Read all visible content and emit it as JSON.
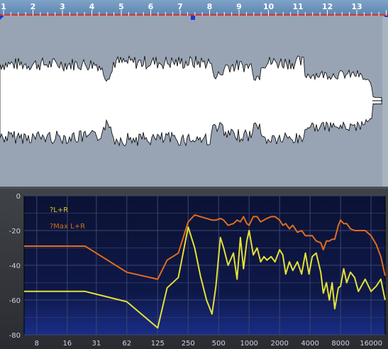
{
  "waveform": {
    "ruler_labels": [
      "1",
      "2",
      "3",
      "4",
      "5",
      "6",
      "7",
      "8",
      "9",
      "10",
      "11",
      "12",
      "13"
    ],
    "colors": {
      "background": "#98a4b3",
      "wave_fill": "#ffffff",
      "ruler_bg": "#6a90b9",
      "ruler_line": "#c83a36",
      "marker": "#1e39c8"
    }
  },
  "spectrum": {
    "legend": {
      "lr_label": "?L+R",
      "max_label": "?Max L+R"
    },
    "colors": {
      "plot_bg_top": "#0c1233",
      "plot_bg_bottom": "#1a2d88",
      "grid": "#3c4670",
      "lr_line": "#e3e037",
      "max_line": "#e26c1c",
      "label_text": "#cfd3da",
      "lr_legend": "#d6cd2c",
      "max_legend": "#d2701c"
    },
    "y_tick_labels": [
      "0",
      "-20",
      "-40",
      "-60",
      "-80"
    ],
    "x_tick_labels": [
      "8",
      "16",
      "31",
      "62",
      "125",
      "250",
      "500",
      "1000",
      "2000",
      "4000",
      "8000",
      "16000"
    ]
  },
  "chart_data": {
    "type": "line",
    "xscale": "log",
    "xlabel": "",
    "ylabel": "",
    "xlim": [
      6,
      22050
    ],
    "ylim": [
      -80,
      0
    ],
    "grid": true,
    "legend_position": "top-left",
    "series": [
      {
        "name": "?L+R",
        "x": [
          6,
          16,
          24,
          62,
          125,
          155,
          200,
          250,
          290,
          330,
          380,
          430,
          470,
          520,
          560,
          620,
          700,
          760,
          820,
          880,
          950,
          1000,
          1100,
          1200,
          1300,
          1400,
          1500,
          1650,
          1800,
          2000,
          2150,
          2300,
          2500,
          2700,
          3000,
          3300,
          3600,
          3900,
          4200,
          4600,
          5100,
          5400,
          5800,
          6200,
          6600,
          7000,
          7600,
          8000,
          8600,
          9200,
          10000,
          11000,
          12000,
          14000,
          16000,
          18000,
          20000,
          22000
        ],
        "values": [
          -55,
          -55,
          -55,
          -61,
          -76,
          -53,
          -47,
          -18,
          -30,
          -46,
          -60,
          -68,
          -52,
          -24,
          -30,
          -40,
          -33,
          -48,
          -24,
          -42,
          -26,
          -20,
          -34,
          -30,
          -38,
          -35,
          -37,
          -35,
          -38,
          -31,
          -34,
          -45,
          -38,
          -43,
          -38,
          -45,
          -33,
          -45,
          -35,
          -33,
          -44,
          -56,
          -50,
          -60,
          -50,
          -65,
          -53,
          -52,
          -42,
          -50,
          -44,
          -47,
          -55,
          -48,
          -55,
          -52,
          -48,
          -60
        ]
      },
      {
        "name": "?Max L+R",
        "x": [
          6,
          16,
          24,
          62,
          125,
          155,
          200,
          250,
          290,
          330,
          380,
          430,
          470,
          520,
          560,
          620,
          700,
          760,
          820,
          880,
          950,
          1000,
          1100,
          1200,
          1300,
          1400,
          1500,
          1650,
          1800,
          2000,
          2150,
          2300,
          2500,
          2700,
          3000,
          3300,
          3600,
          3900,
          4200,
          4600,
          5100,
          5400,
          5800,
          6200,
          6600,
          7000,
          7600,
          8000,
          8600,
          9200,
          10000,
          11000,
          12000,
          14000,
          16000,
          18000,
          20000,
          22000
        ],
        "values": [
          -29,
          -29,
          -29,
          -44,
          -48,
          -37,
          -33,
          -15,
          -11,
          -12,
          -13,
          -14,
          -14,
          -13,
          -14,
          -17,
          -16,
          -14,
          -15,
          -12,
          -16,
          -17,
          -12,
          -12,
          -15,
          -14,
          -13,
          -12,
          -12,
          -14,
          -17,
          -16,
          -19,
          -17,
          -21,
          -20,
          -23,
          -23,
          -23,
          -26,
          -27,
          -31,
          -26,
          -26,
          -25,
          -25,
          -17,
          -14,
          -16,
          -16,
          -19,
          -20,
          -20,
          -20,
          -23,
          -28,
          -35,
          -46
        ]
      }
    ]
  }
}
